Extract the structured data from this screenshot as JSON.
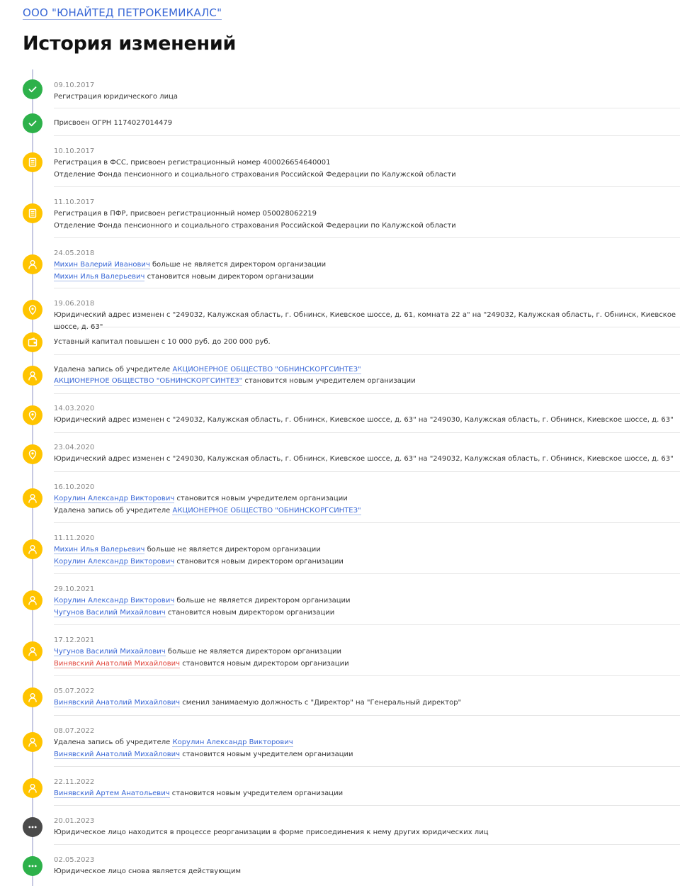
{
  "company": "ООО \"ЮНАЙТЕД ПЕТРОКЕМИКАЛС\"",
  "title": "История изменений",
  "colors": {
    "green": "#2db14a",
    "yellow": "#ffc400",
    "dark": "#4a4a4a",
    "link": "#3867d6",
    "link_red": "#e0443a"
  },
  "events": [
    {
      "marker": "green",
      "icon": "check-icon",
      "date": "09.10.2017",
      "lines": [
        [
          {
            "t": "Регистрация юридического лица"
          }
        ]
      ]
    },
    {
      "marker": "green",
      "icon": "check-icon",
      "date": "",
      "lines": [
        [
          {
            "t": "Присвоен ОГРН 1174027014479"
          }
        ]
      ]
    },
    {
      "marker": "yellow",
      "icon": "document-icon",
      "date": "10.10.2017",
      "lines": [
        [
          {
            "t": "Регистрация в ФСС, присвоен регистрационный номер 400026654640001"
          }
        ],
        [
          {
            "t": "Отделение Фонда пенсионного и социального страхования Российской Федерации по Калужской области"
          }
        ]
      ]
    },
    {
      "marker": "yellow",
      "icon": "document-icon",
      "date": "11.10.2017",
      "lines": [
        [
          {
            "t": "Регистрация в ПФР, присвоен регистрационный номер 050028062219"
          }
        ],
        [
          {
            "t": "Отделение Фонда пенсионного и социального страхования Российской Федерации по Калужской области"
          }
        ]
      ]
    },
    {
      "marker": "yellow",
      "icon": "person-icon",
      "date": "24.05.2018",
      "lines": [
        [
          {
            "t": "Михин Валерий Иванович",
            "link": true
          },
          {
            "t": " больше не является директором организации"
          }
        ],
        [
          {
            "t": "Михин Илья Валерьевич",
            "link": true
          },
          {
            "t": " становится новым директором организации"
          }
        ]
      ]
    },
    {
      "marker": "yellow",
      "icon": "location-icon",
      "date": "19.06.2018",
      "lines": [
        [
          {
            "t": "Юридический адрес изменен с \"249032, Калужская область, г. Обнинск, Киевское шоссе, д. 61, комната 22 а\" на \"249032, Калужская область, г. Обнинск, Киевское шоссе, д. 63\""
          }
        ]
      ]
    },
    {
      "marker": "yellow",
      "icon": "wallet-icon",
      "date": "",
      "lines": [
        [
          {
            "t": "Уставный капитал повышен с 10 000 руб. до 200 000 руб."
          }
        ]
      ]
    },
    {
      "marker": "yellow",
      "icon": "person-icon",
      "date": "",
      "lines": [
        [
          {
            "t": "Удалена запись об учредителе "
          },
          {
            "t": "АКЦИОНЕРНОЕ ОБЩЕСТВО \"ОБНИНСКОРГСИНТЕЗ\"",
            "link": true
          }
        ],
        [
          {
            "t": "АКЦИОНЕРНОЕ ОБЩЕСТВО \"ОБНИНСКОРГСИНТЕЗ\"",
            "link": true
          },
          {
            "t": " становится новым учредителем организации"
          }
        ]
      ]
    },
    {
      "marker": "yellow",
      "icon": "location-icon",
      "date": "14.03.2020",
      "lines": [
        [
          {
            "t": "Юридический адрес изменен с \"249032, Калужская область, г. Обнинск, Киевское шоссе, д. 63\" на \"249030, Калужская область, г. Обнинск, Киевское шоссе, д. 63\""
          }
        ]
      ]
    },
    {
      "marker": "yellow",
      "icon": "location-icon",
      "date": "23.04.2020",
      "lines": [
        [
          {
            "t": "Юридический адрес изменен с \"249030, Калужская область, г. Обнинск, Киевское шоссе, д. 63\" на \"249032, Калужская область, г. Обнинск, Киевское шоссе, д. 63\""
          }
        ]
      ]
    },
    {
      "marker": "yellow",
      "icon": "person-icon",
      "date": "16.10.2020",
      "lines": [
        [
          {
            "t": "Корулин Александр Викторович",
            "link": true
          },
          {
            "t": " становится новым учредителем организации"
          }
        ],
        [
          {
            "t": "Удалена запись об учредителе "
          },
          {
            "t": "АКЦИОНЕРНОЕ ОБЩЕСТВО \"ОБНИНСКОРГСИНТЕЗ\"",
            "link": true
          }
        ]
      ]
    },
    {
      "marker": "yellow",
      "icon": "person-icon",
      "date": "11.11.2020",
      "lines": [
        [
          {
            "t": "Михин Илья Валерьевич",
            "link": true
          },
          {
            "t": " больше не является директором организации"
          }
        ],
        [
          {
            "t": "Корулин Александр Викторович",
            "link": true
          },
          {
            "t": " становится новым директором организации"
          }
        ]
      ]
    },
    {
      "marker": "yellow",
      "icon": "person-icon",
      "date": "29.10.2021",
      "lines": [
        [
          {
            "t": "Корулин Александр Викторович",
            "link": true
          },
          {
            "t": " больше не является директором организации"
          }
        ],
        [
          {
            "t": "Чугунов Василий Михайлович",
            "link": true
          },
          {
            "t": " становится новым директором организации"
          }
        ]
      ]
    },
    {
      "marker": "yellow",
      "icon": "person-icon",
      "date": "17.12.2021",
      "lines": [
        [
          {
            "t": "Чугунов Василий Михайлович",
            "link": true
          },
          {
            "t": " больше не является директором организации"
          }
        ],
        [
          {
            "t": "Винявский Анатолий Михайлович",
            "link": true,
            "red": true
          },
          {
            "t": " становится новым директором организации"
          }
        ]
      ]
    },
    {
      "marker": "yellow",
      "icon": "person-icon",
      "date": "05.07.2022",
      "lines": [
        [
          {
            "t": "Винявский Анатолий Михайлович",
            "link": true
          },
          {
            "t": " сменил занимаемую должность с \"Директор\" на \"Генеральный директор\""
          }
        ]
      ]
    },
    {
      "marker": "yellow",
      "icon": "person-icon",
      "date": "08.07.2022",
      "lines": [
        [
          {
            "t": "Удалена запись об учредителе "
          },
          {
            "t": "Корулин Александр Викторович",
            "link": true
          }
        ],
        [
          {
            "t": "Винявский Анатолий Михайлович",
            "link": true
          },
          {
            "t": " становится новым учредителем организации"
          }
        ]
      ]
    },
    {
      "marker": "yellow",
      "icon": "person-icon",
      "date": "22.11.2022",
      "lines": [
        [
          {
            "t": "Винявский Артем Анатольевич",
            "link": true
          },
          {
            "t": " становится новым учредителем организации"
          }
        ]
      ]
    },
    {
      "marker": "dark",
      "icon": "more-icon",
      "date": "20.01.2023",
      "lines": [
        [
          {
            "t": "Юридическое лицо находится в процессе реорганизации в форме присоединения к нему других юридических лиц"
          }
        ]
      ]
    },
    {
      "marker": "green",
      "icon": "more-icon",
      "date": "02.05.2023",
      "lines": [
        [
          {
            "t": "Юридическое лицо снова является действующим"
          }
        ]
      ]
    }
  ]
}
